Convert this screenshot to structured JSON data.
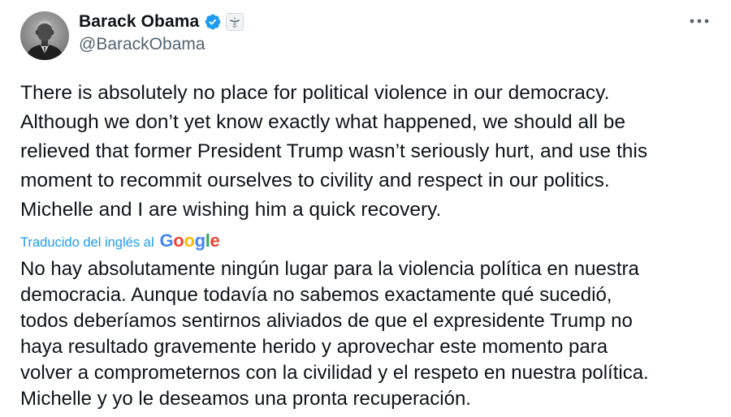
{
  "author": {
    "name": "Barack Obama",
    "handle": "@BarackObama",
    "avatar_icon": "avatar-photo",
    "verified_icon": "verified-badge-icon",
    "affiliation_icon": "government-seal-icon"
  },
  "menu": {
    "more_icon": "more-options-icon",
    "more_label": "•••"
  },
  "tweet": {
    "text": "There is absolutely no place for political violence in our democracy.\nAlthough we don’t yet know exactly what happened, we should all be\nrelieved that former President Trump wasn’t seriously hurt, and use this\nmoment to recommit ourselves to civility and respect in our politics.\nMichelle and I are wishing him a quick recovery."
  },
  "translation": {
    "label": "Traducido del inglés al",
    "provider": "Google",
    "text": "No hay absolutamente ningún lugar para la violencia política en nuestra\ndemocracia. Aunque todavía no sabemos exactamente qué sucedió,\ntodos deberíamos sentirnos aliviados de que el expresidente Trump no\nhaya resultado gravemente herido y aprovechar este momento para\nvolver a comprometernos con la civilidad y el respeto en nuestra política.\nMichelle y yo le deseamos una pronta recuperación."
  },
  "colors": {
    "link": "#1d9bf0",
    "verified": "#1d9bf0",
    "secondary_text": "#536471",
    "primary_text": "#0f1419"
  }
}
